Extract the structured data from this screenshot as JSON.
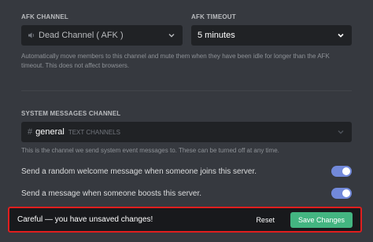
{
  "afk": {
    "channel_label": "AFK CHANNEL",
    "channel_value": "Dead Channel ( AFK )",
    "timeout_label": "AFK TIMEOUT",
    "timeout_value": "5 minutes",
    "hint_line1": "Automatically move members to this channel and mute them when they have been idle for longer than the AFK",
    "hint_line2": "timeout. This does not affect browsers."
  },
  "system": {
    "channel_label": "SYSTEM MESSAGES CHANNEL",
    "channel_value": "general",
    "channel_category": "TEXT CHANNELS",
    "hint": "This is the channel we send system event messages to. These can be turned off at any time.",
    "toggles": [
      {
        "label": "Send a random welcome message when someone joins this server.",
        "on": true
      },
      {
        "label": "Send a message when someone boosts this server.",
        "on": true
      }
    ]
  },
  "savebar": {
    "message": "Careful — you have unsaved changes!",
    "reset_label": "Reset",
    "save_label": "Save Changes"
  },
  "colors": {
    "background": "#36393f",
    "input": "#202225",
    "toggle_on": "#7289da",
    "save_green": "#43b581",
    "highlight_red": "#e01e1e"
  },
  "icons": {
    "voice_channel": "speaker-icon",
    "text_channel": "hashtag-icon",
    "dropdown": "chevron-down-icon"
  }
}
